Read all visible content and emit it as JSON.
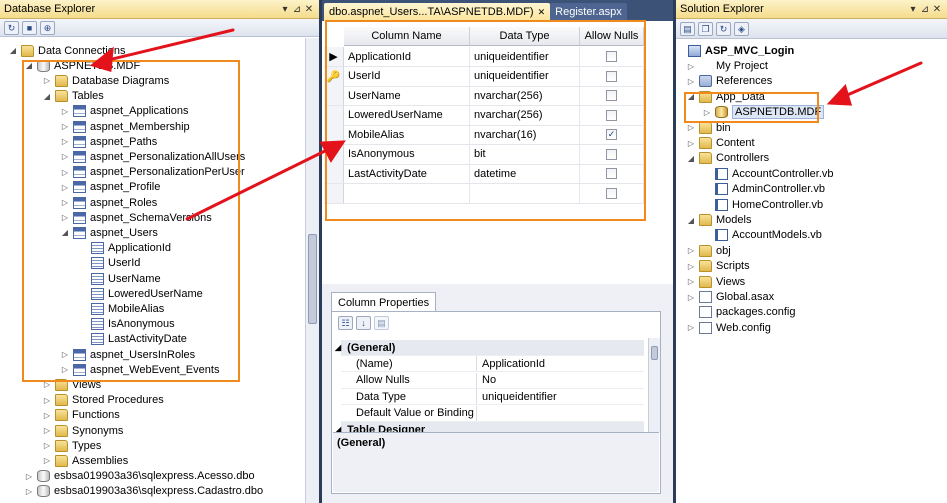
{
  "database_explorer": {
    "title": "Database Explorer",
    "controls": [
      "▾",
      "⊿",
      "✕"
    ],
    "root": "Data Connections",
    "connection": "ASPNETDB.MDF",
    "folders_top": [
      "Database Diagrams",
      "Tables"
    ],
    "tables": [
      "aspnet_Applications",
      "aspnet_Membership",
      "aspnet_Paths",
      "aspnet_PersonalizationAllUsers",
      "aspnet_PersonalizationPerUser",
      "aspnet_Profile",
      "aspnet_Roles",
      "aspnet_SchemaVersions",
      "aspnet_Users"
    ],
    "user_columns": [
      "ApplicationId",
      "UserId",
      "UserName",
      "LoweredUserName",
      "MobileAlias",
      "IsAnonymous",
      "LastActivityDate"
    ],
    "tables_after": [
      "aspnet_UsersInRoles",
      "aspnet_WebEvent_Events"
    ],
    "folders_bottom": [
      "Views",
      "Stored Procedures",
      "Functions",
      "Synonyms",
      "Types",
      "Assemblies"
    ],
    "other_connections": [
      "esbsa019903a36\\sqlexpress.Acesso.dbo",
      "esbsa019903a36\\sqlexpress.Cadastro.dbo"
    ]
  },
  "designer": {
    "tabs": [
      {
        "label": "dbo.aspnet_Users...TA\\ASPNETDB.MDF)",
        "close": "✕"
      },
      {
        "label": "Register.aspx"
      }
    ],
    "columns_header": [
      "Column Name",
      "Data Type",
      "Allow Nulls"
    ],
    "rows": [
      {
        "name": "ApplicationId",
        "type": "uniqueidentifier",
        "nulls": false,
        "marker": "▶"
      },
      {
        "name": "UserId",
        "type": "uniqueidentifier",
        "nulls": false,
        "marker": "🔑"
      },
      {
        "name": "UserName",
        "type": "nvarchar(256)",
        "nulls": false,
        "marker": ""
      },
      {
        "name": "LoweredUserName",
        "type": "nvarchar(256)",
        "nulls": false,
        "marker": ""
      },
      {
        "name": "MobileAlias",
        "type": "nvarchar(16)",
        "nulls": true,
        "marker": ""
      },
      {
        "name": "IsAnonymous",
        "type": "bit",
        "nulls": false,
        "marker": ""
      },
      {
        "name": "LastActivityDate",
        "type": "datetime",
        "nulls": false,
        "marker": ""
      },
      {
        "name": "",
        "type": "",
        "nulls": false,
        "marker": ""
      }
    ],
    "check_glyph": "✓"
  },
  "column_properties": {
    "tab": "Column Properties",
    "rows": [
      {
        "name": "(General)",
        "value": "",
        "category": true
      },
      {
        "name": "(Name)",
        "value": "ApplicationId"
      },
      {
        "name": "Allow Nulls",
        "value": "No"
      },
      {
        "name": "Data Type",
        "value": "uniqueidentifier"
      },
      {
        "name": "Default Value or Binding",
        "value": ""
      },
      {
        "name": "Table Designer",
        "value": "",
        "category": true
      }
    ],
    "description": "(General)"
  },
  "solution_explorer": {
    "title": "Solution Explorer",
    "controls": [
      "▾",
      "⊿",
      "✕"
    ],
    "project": "ASP_MVC_Login",
    "items": [
      {
        "label": "My Project",
        "icon": "project",
        "level": 1,
        "exp": "▷"
      },
      {
        "label": "References",
        "icon": "ref",
        "level": 1,
        "exp": "▷"
      },
      {
        "label": "App_Data",
        "icon": "folder",
        "level": 1,
        "exp": "◢"
      },
      {
        "label": "ASPNETDB.MDF",
        "icon": "dbgold",
        "level": 2,
        "exp": "▷"
      },
      {
        "label": "bin",
        "icon": "folder",
        "level": 1,
        "exp": "▷"
      },
      {
        "label": "Content",
        "icon": "folder",
        "level": 1,
        "exp": "▷"
      },
      {
        "label": "Controllers",
        "icon": "folder",
        "level": 1,
        "exp": "◢"
      },
      {
        "label": "AccountController.vb",
        "icon": "vb",
        "level": 2,
        "exp": ""
      },
      {
        "label": "AdminController.vb",
        "icon": "vb",
        "level": 2,
        "exp": ""
      },
      {
        "label": "HomeController.vb",
        "icon": "vb",
        "level": 2,
        "exp": ""
      },
      {
        "label": "Models",
        "icon": "folder",
        "level": 1,
        "exp": "◢"
      },
      {
        "label": "AccountModels.vb",
        "icon": "vb",
        "level": 2,
        "exp": ""
      },
      {
        "label": "obj",
        "icon": "folder",
        "level": 1,
        "exp": "▷"
      },
      {
        "label": "Scripts",
        "icon": "folder",
        "level": 1,
        "exp": "▷"
      },
      {
        "label": "Views",
        "icon": "folder",
        "level": 1,
        "exp": "▷"
      },
      {
        "label": "Global.asax",
        "icon": "file",
        "level": 1,
        "exp": "▷"
      },
      {
        "label": "packages.config",
        "icon": "file",
        "level": 1,
        "exp": ""
      },
      {
        "label": "Web.config",
        "icon": "file",
        "level": 1,
        "exp": "▷"
      }
    ]
  },
  "colors": {
    "annotation_orange": "#f08a1c",
    "annotation_red": "#e3121b",
    "ide_background": "#2b3c59"
  }
}
